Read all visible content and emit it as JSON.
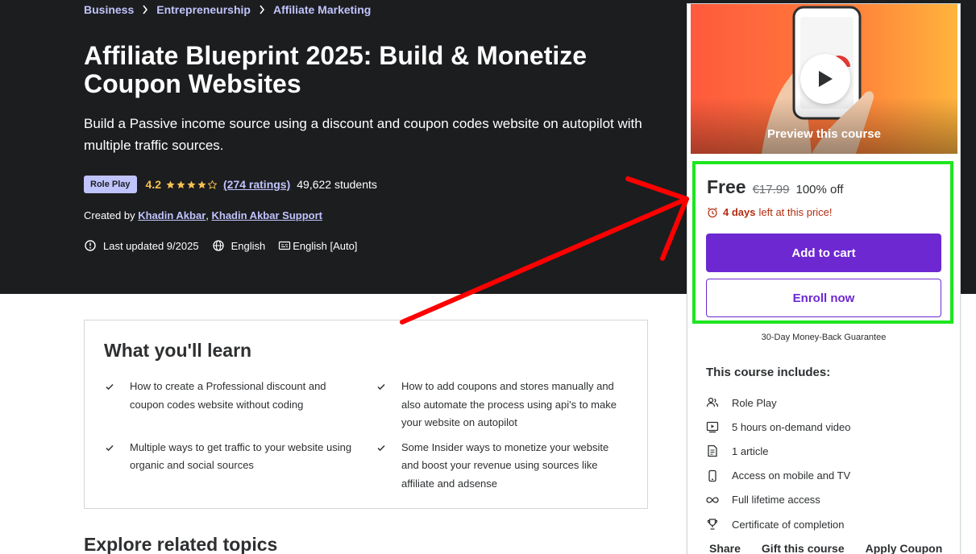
{
  "breadcrumb": [
    "Business",
    "Entrepreneurship",
    "Affiliate Marketing"
  ],
  "course": {
    "title": "Affiliate Blueprint 2025: Build & Monetize Coupon Websites",
    "subtitle": "Build a Passive income source using a discount and coupon codes website on autopilot with multiple traffic sources.",
    "badge": "Role Play",
    "rating": "4.2",
    "stars": 4.2,
    "ratings_count": "(274 ratings)",
    "students": "49,622 students",
    "created_by_label": "Created by",
    "authors": [
      "Khadin Akbar",
      "Khadin Akbar Support"
    ],
    "author_separator": ",",
    "last_updated": "Last updated 9/2025",
    "language": "English",
    "captions": "English [Auto]"
  },
  "learn": {
    "heading": "What you'll learn",
    "items": [
      "How to create a Professional discount and coupon codes website without coding",
      "How to add coupons and stores manually and also automate the process using api's to make your website on autopilot",
      "Multiple ways to get traffic to your website using organic and social sources",
      "Some Insider ways to monetize your website and boost your revenue using sources like affiliate and adsense"
    ]
  },
  "explore_heading": "Explore related topics",
  "card": {
    "preview_label": "Preview this course",
    "price_now": "Free",
    "price_old": "€17.99",
    "discount": "100% off",
    "timer_days": "4 days",
    "timer_text": "left at this price!",
    "add_to_cart": "Add to cart",
    "enroll_now": "Enroll now",
    "guarantee": "30-Day Money-Back Guarantee",
    "includes_title": "This course includes:",
    "includes": [
      {
        "label": "Role Play",
        "icon": "people-icon"
      },
      {
        "label": "5 hours on-demand video",
        "icon": "video-icon"
      },
      {
        "label": "1 article",
        "icon": "article-icon"
      },
      {
        "label": "Access on mobile and TV",
        "icon": "mobile-icon"
      },
      {
        "label": "Full lifetime access",
        "icon": "infinity-icon"
      },
      {
        "label": "Certificate of completion",
        "icon": "trophy-icon"
      }
    ],
    "links": [
      "Share",
      "Gift this course",
      "Apply Coupon"
    ]
  },
  "colors": {
    "hero_bg": "#1c1d1f",
    "accent_purple": "#6d28d2",
    "link_lavender": "#c0c4fc",
    "star_gold": "#f4c150",
    "timer_red": "#b32d0f",
    "annotation_green": "#1ee61e",
    "annotation_red": "#ff0000"
  }
}
